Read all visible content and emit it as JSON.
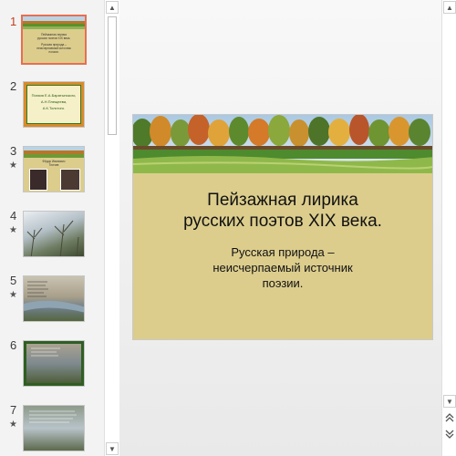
{
  "slides_panel": {
    "items": [
      {
        "number": "1",
        "has_animation": false,
        "active": true
      },
      {
        "number": "2",
        "has_animation": false,
        "active": false
      },
      {
        "number": "3",
        "has_animation": true,
        "active": false
      },
      {
        "number": "4",
        "has_animation": true,
        "active": false
      },
      {
        "number": "5",
        "has_animation": true,
        "active": false
      },
      {
        "number": "6",
        "has_animation": false,
        "active": false
      },
      {
        "number": "7",
        "has_animation": true,
        "active": false
      }
    ],
    "animation_mark": "★",
    "thumb1": {
      "line1": "Пейзажная лирика",
      "line2": "русских поэтов XIX века.",
      "line3": "Русская природа –",
      "line4": "неисчерпаемый источник",
      "line5": "поэзии."
    },
    "thumb2": {
      "line1": "Поэзия Е.А.Баратынского,",
      "line2": "А.Н.Плещеева,",
      "line3": "А.К.Толстого."
    },
    "thumb3": {
      "line1": "Фёдор Иванович",
      "line2": "Тютчев"
    }
  },
  "slide": {
    "title_line1": "Пейзажная лирика",
    "title_line2": "русских поэтов XIX века.",
    "subtitle_line1": "Русская природа –",
    "subtitle_line2": "неисчерпаемый источник",
    "subtitle_line3": "поэзии."
  },
  "scrollbar": {
    "up": "▲",
    "down": "▼",
    "prev_slide": "⯭",
    "next_slide": "⯯"
  },
  "colors": {
    "slide_bg": "#dccd8d",
    "active_border": "#e86e50",
    "active_number": "#c43e1c",
    "thumb2_border": "#2f7a1f"
  }
}
